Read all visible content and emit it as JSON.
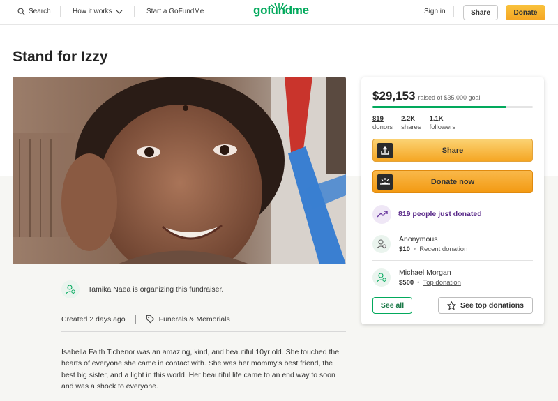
{
  "header": {
    "search_label": "Search",
    "how_it_works_label": "How it works",
    "start_label": "Start a GoFundMe",
    "logo_text": "gofundme",
    "sign_in_label": "Sign in",
    "share_label": "Share",
    "donate_label": "Donate"
  },
  "campaign": {
    "title": "Stand for Izzy",
    "organizer_text": "Tamika Naea is organizing this fundraiser.",
    "created": "Created 2 days ago",
    "category": "Funerals & Memorials",
    "story": "Isabella Faith Tichenor was an amazing, kind, and beautiful 10yr old. She touched the hearts of everyone she came in contact with. She was her mommy's best friend, the best big sister, and a light in this world. Her beautiful life came to an end way to soon and was a shock to everyone."
  },
  "donation_card": {
    "amount_raised": "$29,153",
    "goal_text": "raised of $35,000 goal",
    "progress_fraction": 0.833,
    "stats": [
      {
        "value": "819",
        "label": "donors"
      },
      {
        "value": "2.2K",
        "label": "shares"
      },
      {
        "value": "1.1K",
        "label": "followers"
      }
    ],
    "share_label": "Share",
    "donate_now_label": "Donate now",
    "just_donated_text": "819 people just donated",
    "donors": [
      {
        "name": "Anonymous",
        "amount": "$10",
        "tag": "Recent donation"
      },
      {
        "name": "Michael Morgan",
        "amount": "$500",
        "tag": "Top donation"
      }
    ],
    "see_all_label": "See all",
    "see_top_label": "See top donations"
  },
  "colors": {
    "brand_green": "#02a95c",
    "accent_orange": "#f5a623",
    "purple": "#5a2a8a"
  }
}
